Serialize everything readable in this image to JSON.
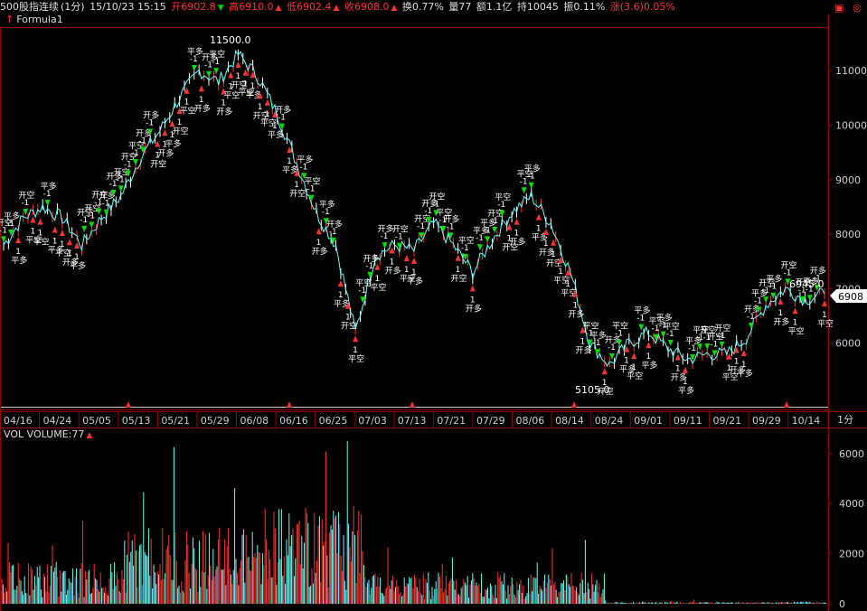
{
  "header": {
    "symbol": "500股指连续",
    "period": "(1分)",
    "datetime": "15/10/23 15:15",
    "open_label": "开6902.8",
    "high_label": "高6910.0",
    "low_label": "低6902.4",
    "close_label": "收6908.0",
    "turnover_label": "换0.77%",
    "volume_label": "量77",
    "amount_label": "额1.1亿",
    "position_label": "持10045",
    "amplitude_label": "振0.11%",
    "change_label": "涨(3.6)0.05%"
  },
  "formula_label": "Formula1",
  "vol_header": "VOL VOLUME:77",
  "price_axis": {
    "ticks": [
      "11000",
      "10000",
      "9000",
      "8000",
      "7000",
      "6000"
    ],
    "current_price": "6908"
  },
  "volume_axis": {
    "ticks": [
      "6000",
      "4000",
      "2000",
      "0"
    ]
  },
  "period_tag": "1分",
  "date_labels": [
    "04/16",
    "04/24",
    "05/05",
    "05/13",
    "05/21",
    "05/29",
    "06/08",
    "06/16",
    "06/25",
    "07/03",
    "07/13",
    "07/21",
    "07/29",
    "08/06",
    "08/14",
    "08/24",
    "09/01",
    "09/11",
    "09/21",
    "09/29",
    "10/14"
  ],
  "annotations": {
    "high_mark": "11500.0",
    "low_mark": "5105.0",
    "last_mark": "6945.0"
  },
  "signal_labels": {
    "open_long": "开多",
    "open_short": "开空",
    "close": "平空",
    "close_long": "平多",
    "plus": "1",
    "minus": "-1"
  },
  "colors": {
    "up": "#ff3333",
    "down": "#00dd00",
    "line": "#66ffff",
    "grid": "#8b0000",
    "text": "#cccccc"
  },
  "chart_data": {
    "type": "line",
    "price_ylim": [
      5000,
      11800
    ],
    "volume_ylim": [
      0,
      6500
    ],
    "price_series": [
      [
        "04/16",
        7800
      ],
      [
        "04/20",
        8300
      ],
      [
        "04/24",
        8500
      ],
      [
        "04/28",
        8300
      ],
      [
        "05/05",
        7800
      ],
      [
        "05/08",
        8300
      ],
      [
        "05/13",
        8700
      ],
      [
        "05/18",
        9400
      ],
      [
        "05/21",
        9900
      ],
      [
        "05/25",
        10500
      ],
      [
        "05/29",
        11000
      ],
      [
        "06/03",
        10800
      ],
      [
        "06/08",
        11300
      ],
      [
        "06/12",
        10900
      ],
      [
        "06/16",
        10200
      ],
      [
        "06/19",
        9300
      ],
      [
        "06/25",
        8400
      ],
      [
        "06/29",
        7800
      ],
      [
        "07/03",
        6200
      ],
      [
        "07/08",
        7600
      ],
      [
        "07/13",
        7800
      ],
      [
        "07/17",
        7700
      ],
      [
        "07/21",
        8200
      ],
      [
        "07/24",
        7800
      ],
      [
        "07/29",
        7300
      ],
      [
        "08/03",
        7900
      ],
      [
        "08/06",
        8400
      ],
      [
        "08/10",
        8700
      ],
      [
        "08/14",
        8200
      ],
      [
        "08/18",
        7300
      ],
      [
        "08/24",
        6000
      ],
      [
        "08/27",
        5600
      ],
      [
        "09/01",
        6000
      ],
      [
        "09/07",
        6200
      ],
      [
        "09/11",
        5900
      ],
      [
        "09/16",
        5700
      ],
      [
        "09/21",
        5800
      ],
      [
        "09/25",
        5800
      ],
      [
        "09/29",
        6100
      ],
      [
        "10/08",
        6700
      ],
      [
        "10/14",
        7000
      ],
      [
        "10/19",
        6800
      ],
      [
        "10/23",
        6908
      ]
    ]
  }
}
